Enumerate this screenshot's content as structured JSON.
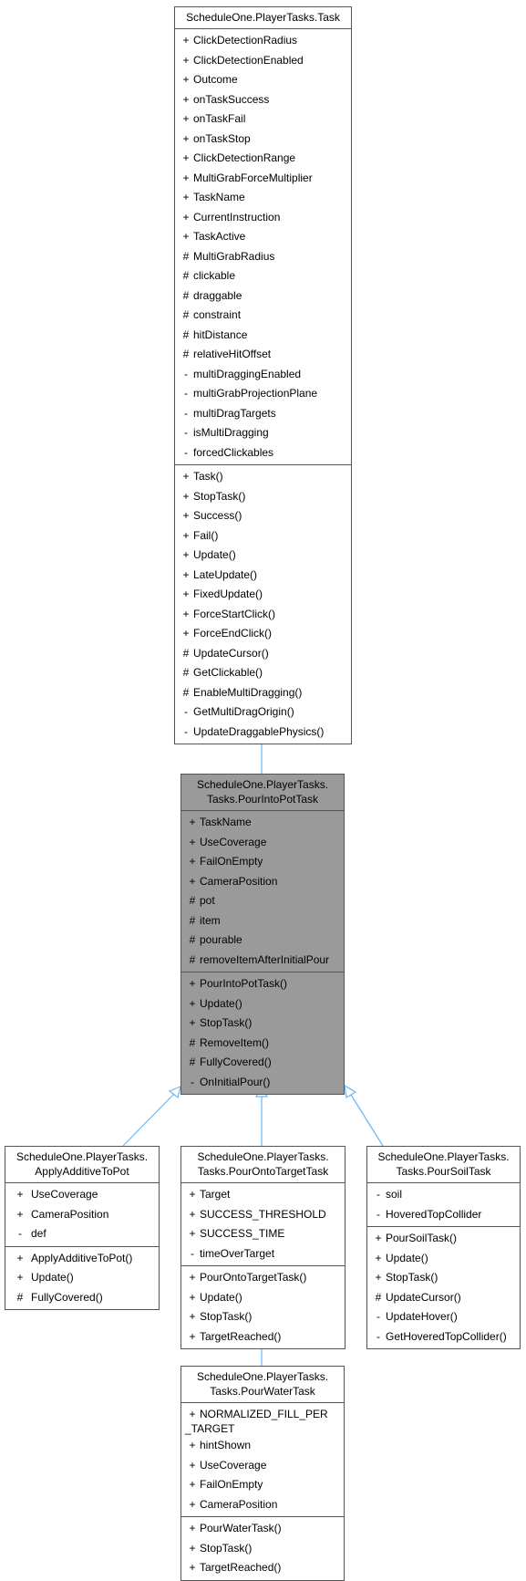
{
  "classes": {
    "task": {
      "title": "ScheduleOne.PlayerTasks.Task",
      "attributes": [
        {
          "vis": "+",
          "name": "ClickDetectionRadius"
        },
        {
          "vis": "+",
          "name": "ClickDetectionEnabled"
        },
        {
          "vis": "+",
          "name": "Outcome"
        },
        {
          "vis": "+",
          "name": "onTaskSuccess"
        },
        {
          "vis": "+",
          "name": "onTaskFail"
        },
        {
          "vis": "+",
          "name": "onTaskStop"
        },
        {
          "vis": "+",
          "name": "ClickDetectionRange"
        },
        {
          "vis": "+",
          "name": "MultiGrabForceMultiplier"
        },
        {
          "vis": "+",
          "name": "TaskName"
        },
        {
          "vis": "+",
          "name": "CurrentInstruction"
        },
        {
          "vis": "+",
          "name": "TaskActive"
        },
        {
          "vis": "#",
          "name": "MultiGrabRadius"
        },
        {
          "vis": "#",
          "name": "clickable"
        },
        {
          "vis": "#",
          "name": "draggable"
        },
        {
          "vis": "#",
          "name": "constraint"
        },
        {
          "vis": "#",
          "name": "hitDistance"
        },
        {
          "vis": "#",
          "name": "relativeHitOffset"
        },
        {
          "vis": "-",
          "name": "multiDraggingEnabled"
        },
        {
          "vis": "-",
          "name": "multiGrabProjectionPlane"
        },
        {
          "vis": "-",
          "name": "multiDragTargets"
        },
        {
          "vis": "-",
          "name": "isMultiDragging"
        },
        {
          "vis": "-",
          "name": "forcedClickables"
        }
      ],
      "methods": [
        {
          "vis": "+",
          "name": "Task()"
        },
        {
          "vis": "+",
          "name": "StopTask()"
        },
        {
          "vis": "+",
          "name": "Success()"
        },
        {
          "vis": "+",
          "name": "Fail()"
        },
        {
          "vis": "+",
          "name": "Update()"
        },
        {
          "vis": "+",
          "name": "LateUpdate()"
        },
        {
          "vis": "+",
          "name": "FixedUpdate()"
        },
        {
          "vis": "+",
          "name": "ForceStartClick()"
        },
        {
          "vis": "+",
          "name": "ForceEndClick()"
        },
        {
          "vis": "#",
          "name": "UpdateCursor()"
        },
        {
          "vis": "#",
          "name": "GetClickable()"
        },
        {
          "vis": "#",
          "name": "EnableMultiDragging()"
        },
        {
          "vis": "-",
          "name": "GetMultiDragOrigin()"
        },
        {
          "vis": "-",
          "name": "UpdateDraggablePhysics()"
        }
      ]
    },
    "pourIntoPot": {
      "title": "ScheduleOne.PlayerTasks.\nTasks.PourIntoPotTask",
      "attributes": [
        {
          "vis": "+",
          "name": "TaskName"
        },
        {
          "vis": "+",
          "name": "UseCoverage"
        },
        {
          "vis": "+",
          "name": "FailOnEmpty"
        },
        {
          "vis": "+",
          "name": "CameraPosition"
        },
        {
          "vis": "#",
          "name": "pot"
        },
        {
          "vis": "#",
          "name": "item"
        },
        {
          "vis": "#",
          "name": "pourable"
        },
        {
          "vis": "#",
          "name": "removeItemAfterInitialPour"
        }
      ],
      "methods": [
        {
          "vis": "+",
          "name": "PourIntoPotTask()"
        },
        {
          "vis": "+",
          "name": "Update()"
        },
        {
          "vis": "+",
          "name": "StopTask()"
        },
        {
          "vis": "#",
          "name": "RemoveItem()"
        },
        {
          "vis": "#",
          "name": "FullyCovered()"
        },
        {
          "vis": "-",
          "name": "OnInitialPour()"
        }
      ]
    },
    "applyAdditive": {
      "title": "ScheduleOne.PlayerTasks.\nApplyAdditiveToPot",
      "attributes": [
        {
          "vis": "+",
          "name": "UseCoverage"
        },
        {
          "vis": "+",
          "name": "CameraPosition"
        },
        {
          "vis": "-",
          "name": "def"
        }
      ],
      "methods": [
        {
          "vis": "+",
          "name": "ApplyAdditiveToPot()"
        },
        {
          "vis": "+",
          "name": "Update()"
        },
        {
          "vis": "#",
          "name": "FullyCovered()"
        }
      ]
    },
    "pourOntoTarget": {
      "title": "ScheduleOne.PlayerTasks.\nTasks.PourOntoTargetTask",
      "attributes": [
        {
          "vis": "+",
          "name": "Target"
        },
        {
          "vis": "+",
          "name": "SUCCESS_THRESHOLD"
        },
        {
          "vis": "+",
          "name": "SUCCESS_TIME"
        },
        {
          "vis": "-",
          "name": "timeOverTarget"
        }
      ],
      "methods": [
        {
          "vis": "+",
          "name": "PourOntoTargetTask()"
        },
        {
          "vis": "+",
          "name": "Update()"
        },
        {
          "vis": "+",
          "name": "StopTask()"
        },
        {
          "vis": "+",
          "name": "TargetReached()"
        }
      ]
    },
    "pourSoil": {
      "title": "ScheduleOne.PlayerTasks.\nTasks.PourSoilTask",
      "attributes": [
        {
          "vis": "-",
          "name": "soil"
        },
        {
          "vis": "-",
          "name": "HoveredTopCollider"
        }
      ],
      "methods": [
        {
          "vis": "+",
          "name": "PourSoilTask()"
        },
        {
          "vis": "+",
          "name": "Update()"
        },
        {
          "vis": "+",
          "name": "StopTask()"
        },
        {
          "vis": "#",
          "name": "UpdateCursor()"
        },
        {
          "vis": "-",
          "name": "UpdateHover()"
        },
        {
          "vis": "-",
          "name": "GetHoveredTopCollider()"
        }
      ]
    },
    "pourWater": {
      "title": "ScheduleOne.PlayerTasks.\nTasks.PourWaterTask",
      "attributes": [
        {
          "vis": "+",
          "name": "NORMALIZED_FILL_PER\n_TARGET",
          "tall": true
        },
        {
          "vis": "+",
          "name": "hintShown"
        },
        {
          "vis": "+",
          "name": "UseCoverage"
        },
        {
          "vis": "+",
          "name": "FailOnEmpty"
        },
        {
          "vis": "+",
          "name": "CameraPosition"
        }
      ],
      "methods": [
        {
          "vis": "+",
          "name": "PourWaterTask()"
        },
        {
          "vis": "+",
          "name": "StopTask()"
        },
        {
          "vis": "+",
          "name": "TargetReached()"
        }
      ]
    }
  },
  "colors": {
    "edge": "#63b8ff",
    "border": "#555555",
    "focus_fill": "#9a9a9a"
  }
}
